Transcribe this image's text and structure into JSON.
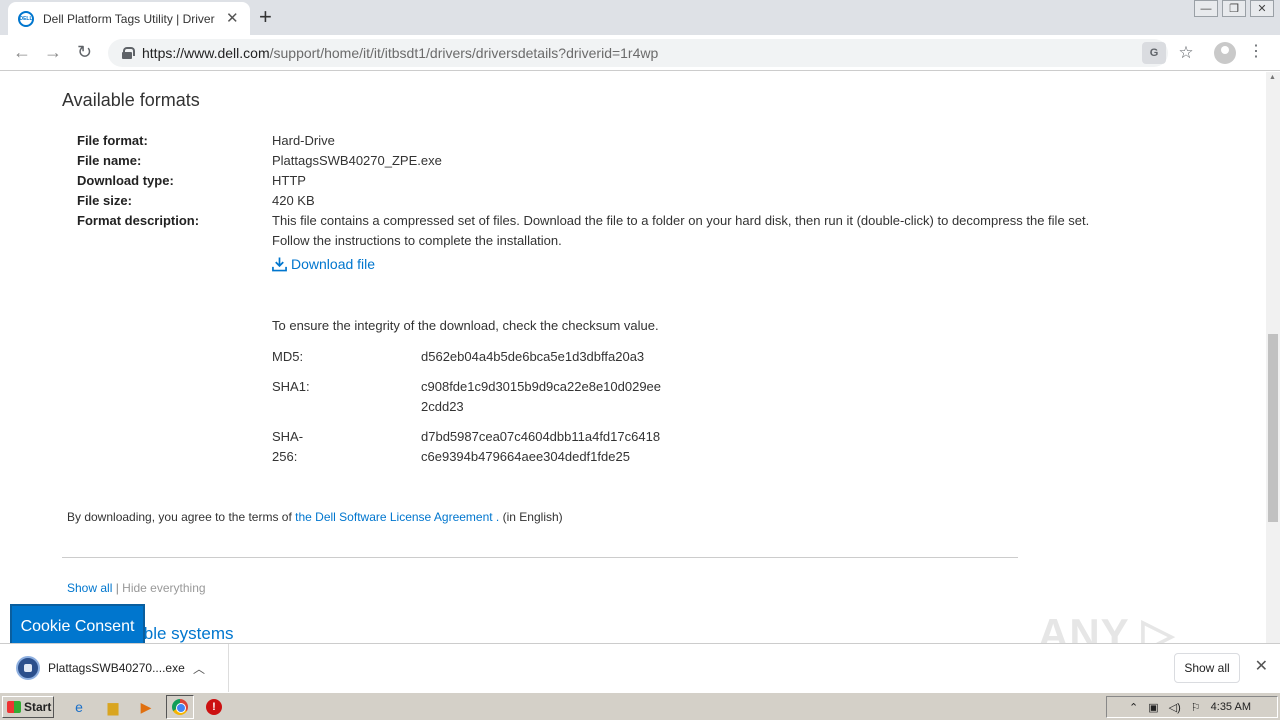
{
  "browser": {
    "tab_title": "Dell Platform Tags Utility | Driver det",
    "favicon_text": "DELL",
    "new_tab": "+",
    "tab_close": "✕",
    "url_host": "https://www.dell.com",
    "url_path": "/support/home/it/it/itbsdt1/drivers/driversdetails?driverid=1r4wp",
    "win_minimize": "—",
    "win_restore": "❐",
    "win_close": "✕"
  },
  "page": {
    "section_title": "Available formats",
    "details": [
      {
        "label": "File format:",
        "value": "Hard-Drive"
      },
      {
        "label": "File name:",
        "value": "PlattagsSWB40270_ZPE.exe"
      },
      {
        "label": "Download type:",
        "value": "HTTP"
      },
      {
        "label": "File size:",
        "value": "420 KB"
      },
      {
        "label": "Format description:",
        "value": "This file contains a compressed set of files. Download the file to a folder on your hard disk, then run it (double-click) to decompress the file set. Follow the instructions to complete the installation."
      }
    ],
    "download_link": "Download file",
    "integrity_text": "To ensure the integrity of the download, check the checksum value.",
    "checksums": [
      {
        "label": "MD5:",
        "value": "d562eb04a4b5de6bca5e1d3dbffa20a3"
      },
      {
        "label": "SHA1:",
        "value": "c908fde1c9d3015b9d9ca22e8e10d029ee 2cdd23"
      },
      {
        "label": "SHA-256:",
        "value": "d7bd5987cea07c4604dbb11a4fd17c6418 c6e9394b479664aee304dedf1fde25"
      }
    ],
    "agreement_prefix": "By downloading, you agree to the terms of",
    "agreement_link": "the Dell Software License Agreement .",
    "agreement_suffix": "(in English)",
    "show_all": "Show all",
    "separator": "|",
    "hide_everything": "Hide everything",
    "compat_title_partial": "ible systems",
    "cookie_button": "Cookie Consent",
    "watermark": "ANY ▷ RUN"
  },
  "download_shelf": {
    "file_name": "PlattagsSWB40270....exe",
    "show_all": "Show all",
    "close": "✕"
  },
  "taskbar": {
    "start": "Start",
    "clock": "4:35 AM"
  },
  "colors": {
    "accent": "#0076ce"
  }
}
